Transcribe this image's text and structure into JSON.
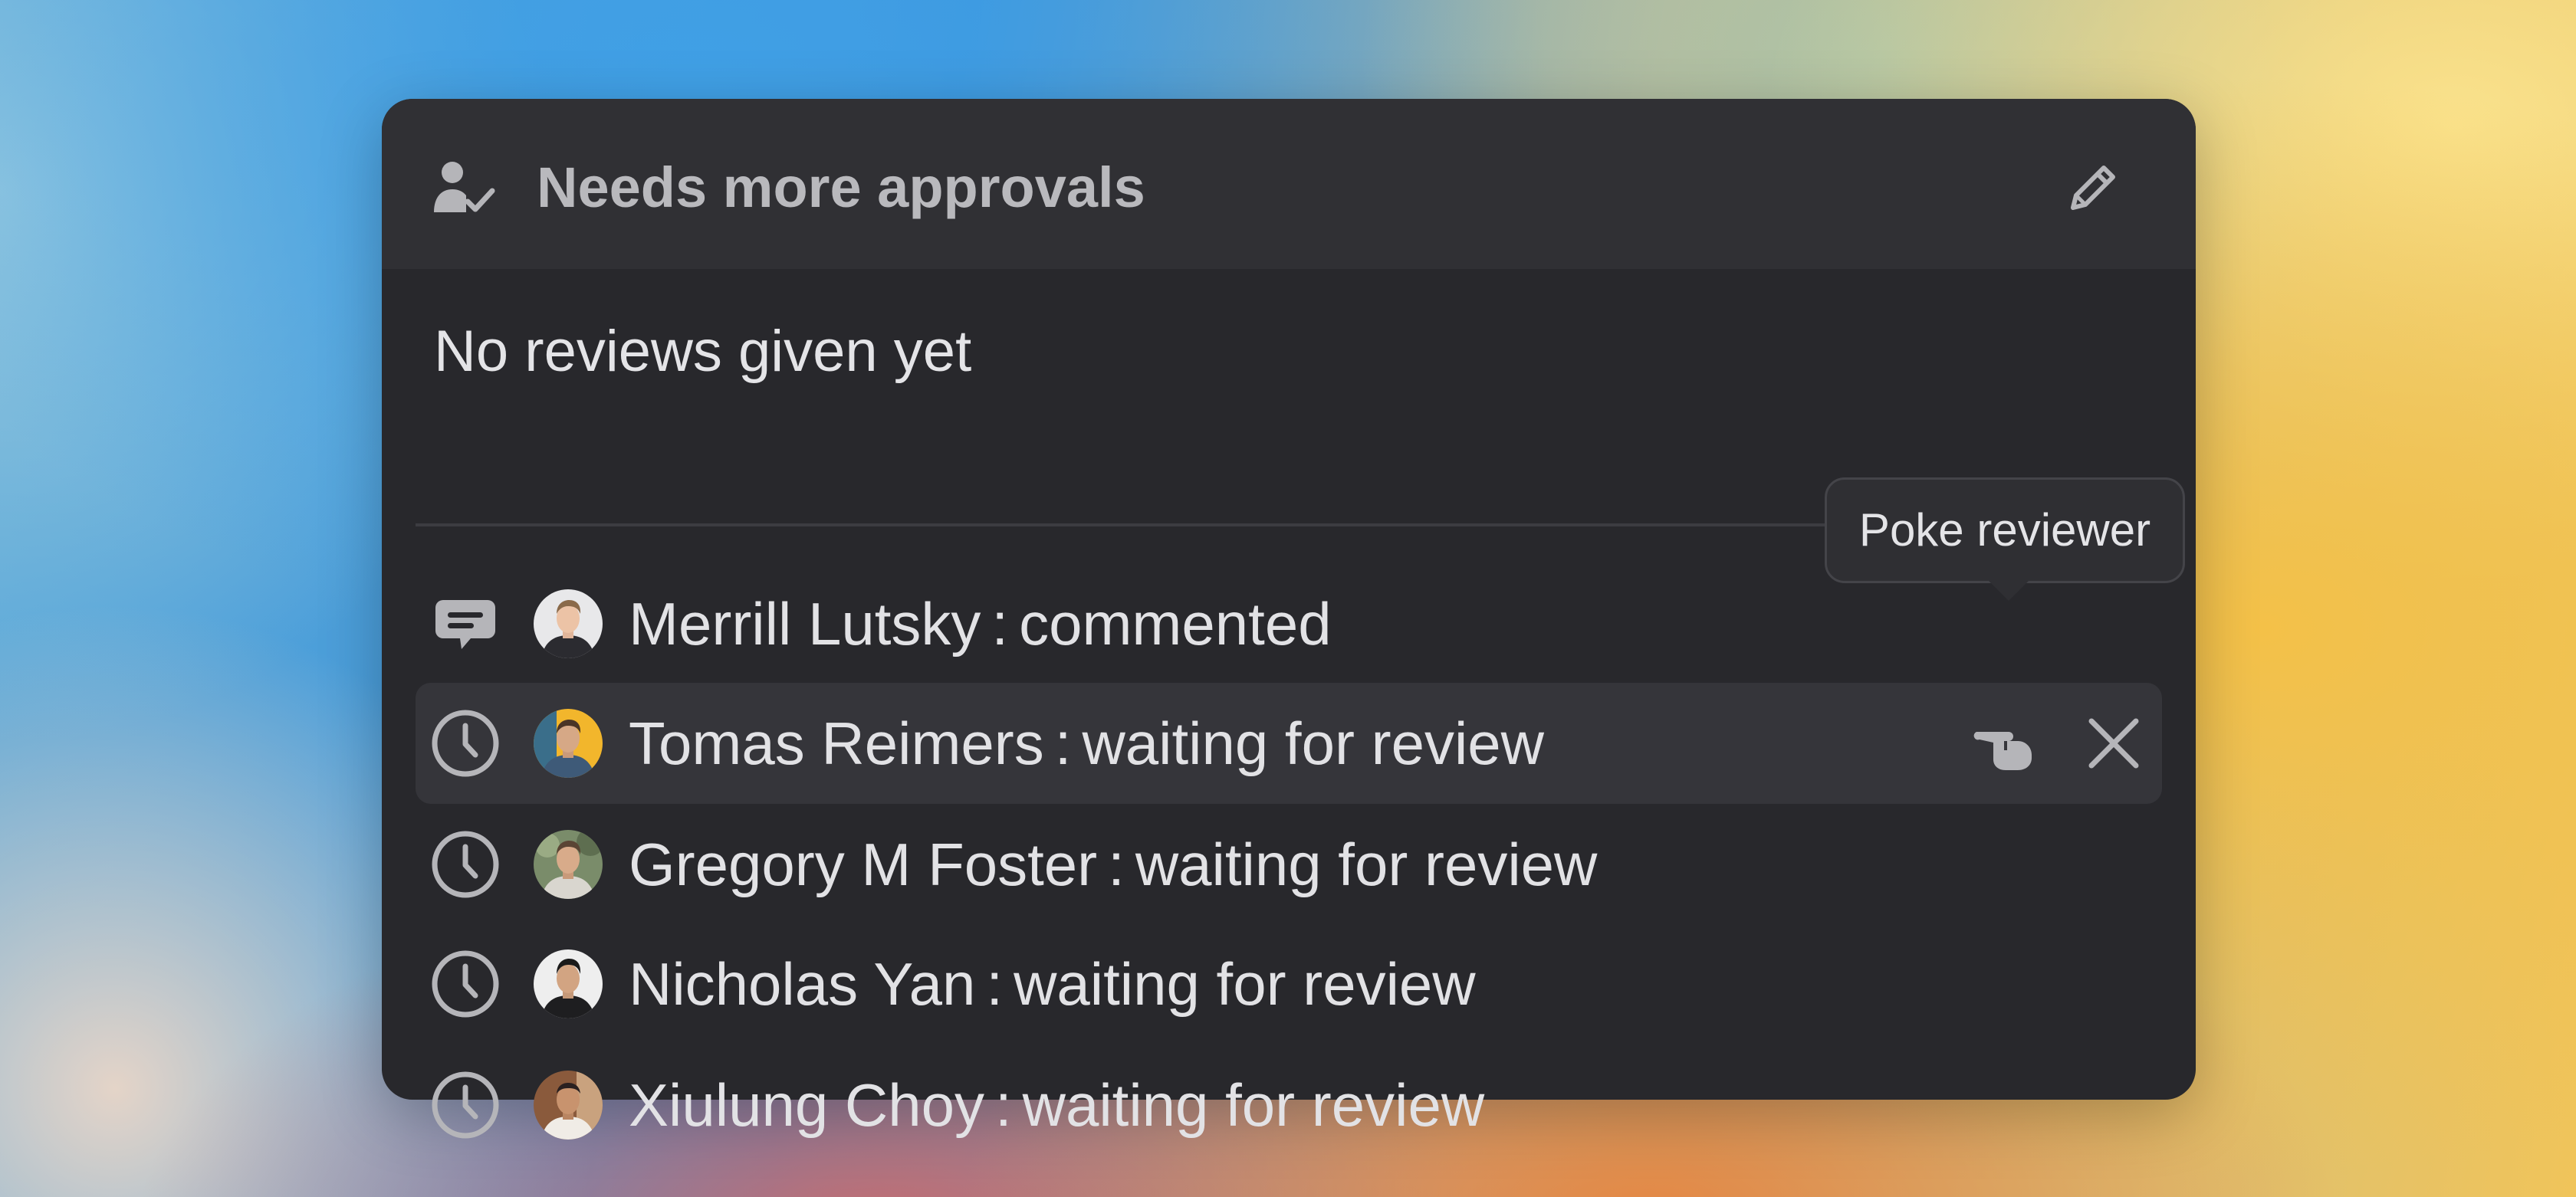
{
  "header": {
    "title": "Needs more approvals",
    "icon": "user-check-icon",
    "edit_icon": "pencil-icon"
  },
  "summary": {
    "text": "No reviews given yet"
  },
  "reviewers": [
    {
      "name": "Merrill Lutsky",
      "status": "commented",
      "status_icon": "comment-icon"
    },
    {
      "name": "Tomas Reimers",
      "status": "waiting for review",
      "status_icon": "clock-icon"
    },
    {
      "name": "Gregory M Foster",
      "status": "waiting for review",
      "status_icon": "clock-icon"
    },
    {
      "name": "Nicholas Yan",
      "status": "waiting for review",
      "status_icon": "clock-icon"
    },
    {
      "name": "Xiulung Choy",
      "status": "waiting for review",
      "status_icon": "clock-icon"
    }
  ],
  "row_actions": {
    "poke_icon": "pointing-hand-icon",
    "remove_icon": "close-icon"
  },
  "tooltip": {
    "text": "Poke reviewer"
  },
  "separator": ":",
  "colors": {
    "card_background": "#28282c",
    "header_background": "#303034",
    "row_hover": "#35353a",
    "text_primary": "#e2e2e5",
    "text_muted": "#b9b9bd"
  }
}
